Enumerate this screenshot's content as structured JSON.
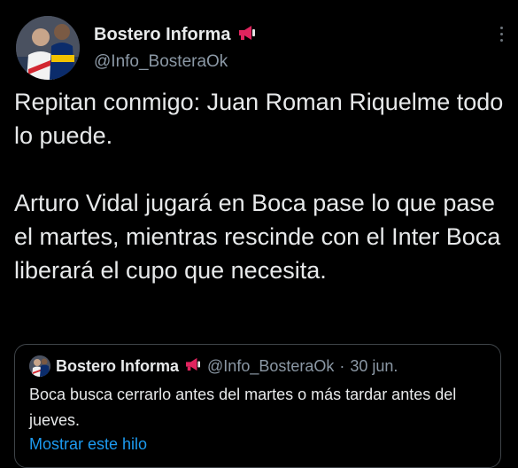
{
  "tweet": {
    "display_name": "Bostero Informa",
    "handle": "@Info_BosteraOk",
    "text": "Repitan conmigo: Juan Roman Riquelme todo lo puede.\n\nArturo Vidal jugará en Boca pase lo que pase el martes, mientras rescinde con el Inter Boca liberará el cupo que necesita."
  },
  "quoted": {
    "display_name": "Bostero Informa",
    "handle": "@Info_BosteraOk",
    "separator": "·",
    "date": "30 jun.",
    "text": "Boca busca cerrarlo antes del martes o más tardar antes del jueves.",
    "show_thread": "Mostrar este hilo"
  },
  "icons": {
    "megaphone": "megaphone-icon",
    "more": "more-options-icon"
  },
  "colors": {
    "background": "#000000",
    "text": "#e7e9ea",
    "secondary": "#8b98a5",
    "link": "#1d9bf0",
    "megaphone": "#e0245e"
  }
}
